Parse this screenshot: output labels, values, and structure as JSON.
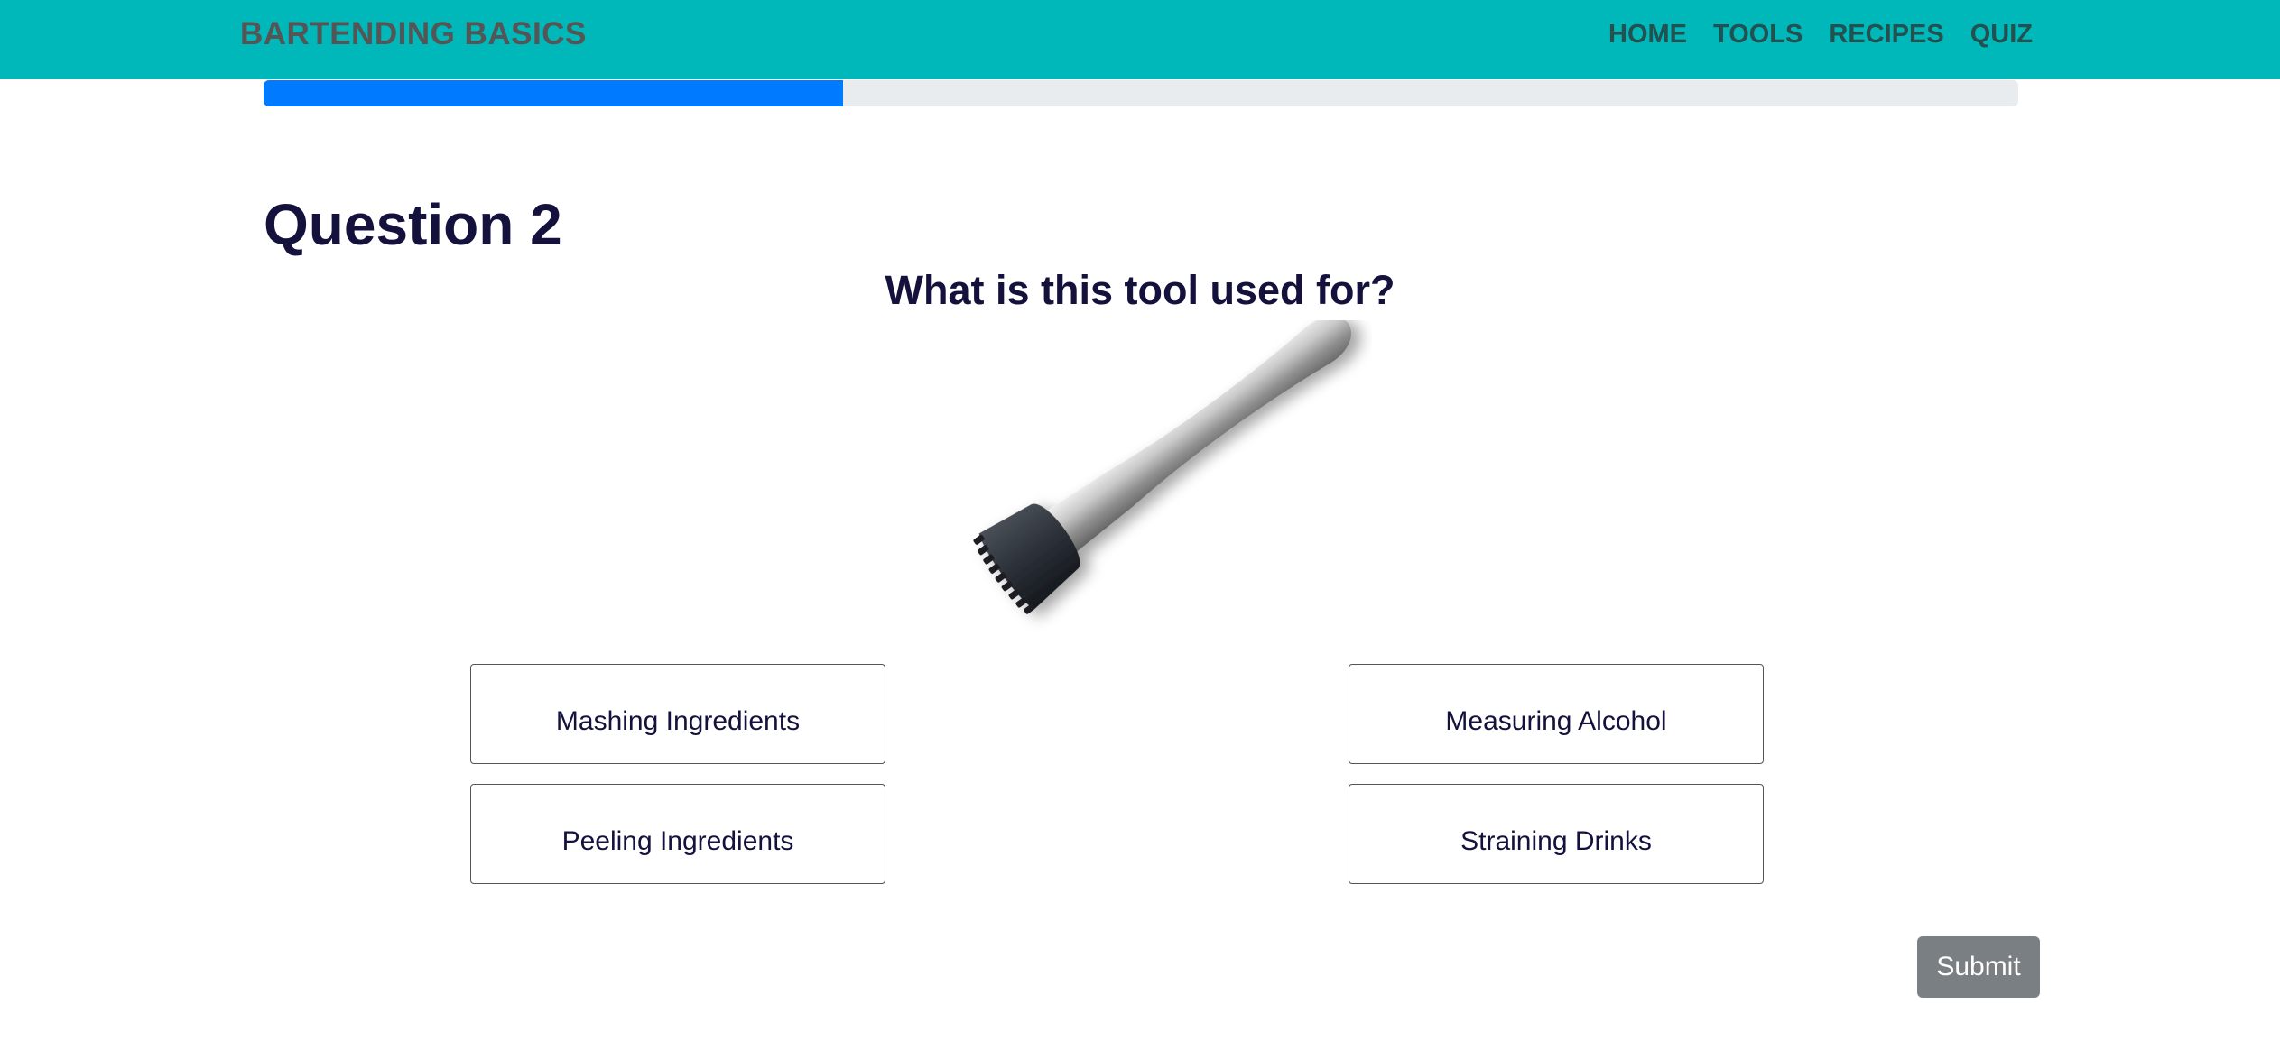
{
  "navbar": {
    "brand": "BARTENDING BASICS",
    "links": [
      {
        "label": "HOME"
      },
      {
        "label": "TOOLS"
      },
      {
        "label": "RECIPES"
      },
      {
        "label": "QUIZ"
      }
    ],
    "background_color": "#00b7b9"
  },
  "progress": {
    "fraction": 0.33,
    "fill_color": "#007bff"
  },
  "question": {
    "title": "Question 2",
    "text": "What is this tool used for?",
    "image_icon": "muddler-icon"
  },
  "answers": [
    {
      "label": "Mashing Ingredients"
    },
    {
      "label": "Measuring Alcohol"
    },
    {
      "label": "Peeling Ingredients"
    },
    {
      "label": "Straining Drinks"
    }
  ],
  "submit": {
    "label": "Submit"
  }
}
